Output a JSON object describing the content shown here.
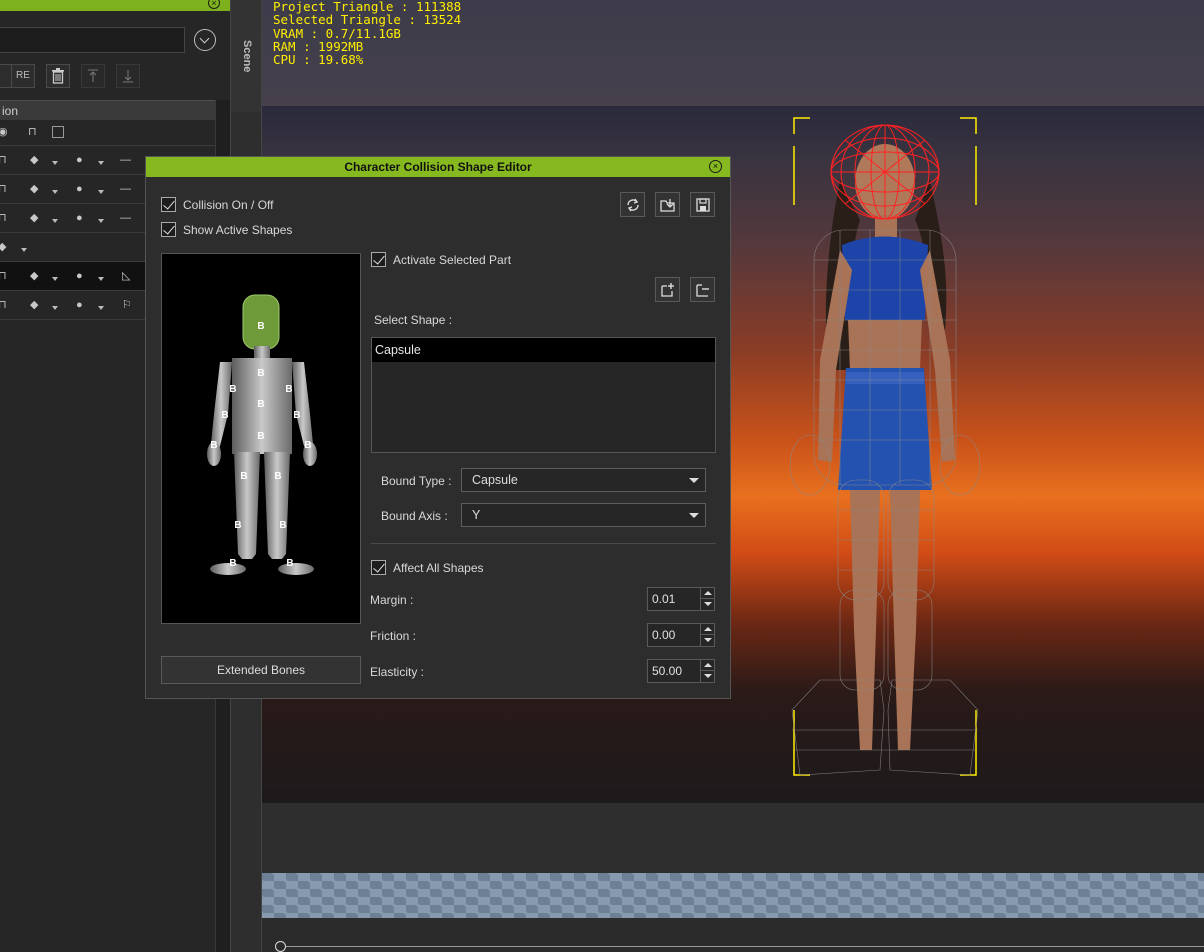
{
  "stats": {
    "project_triangle": "Project Triangle : 111388",
    "selected_triangle": "Selected Triangle : 13524",
    "vram": "VRAM : 0.7/11.1GB",
    "ram": "RAM : 1992MB",
    "cpu": "CPU : 19.68%"
  },
  "left_panel": {
    "tab": "Scene",
    "header": "ion",
    "toolbar_text_button": "RE"
  },
  "dialog": {
    "title": "Character Collision Shape Editor",
    "collision_label": "Collision On / Off",
    "show_active_label": "Show Active Shapes",
    "activate_selected_label": "Activate Selected Part",
    "select_shape_label": "Select Shape :",
    "shapes": [
      "Capsule"
    ],
    "bound_type_label": "Bound Type :",
    "bound_type_value": "Capsule",
    "bound_axis_label": "Bound Axis :",
    "bound_axis_value": "Y",
    "affect_all_label": "Affect All Shapes",
    "margin_label": "Margin :",
    "margin_value": "0.01",
    "friction_label": "Friction :",
    "friction_value": "0.00",
    "elasticity_label": "Elasticity :",
    "elasticity_value": "50.00",
    "extended_bones_label": "Extended Bones",
    "bone_marker": "B",
    "close_glyph": "×"
  },
  "colors": {
    "accent": "#86b91f",
    "stats_text": "#ffee00",
    "active_shape": "#ff2222"
  }
}
